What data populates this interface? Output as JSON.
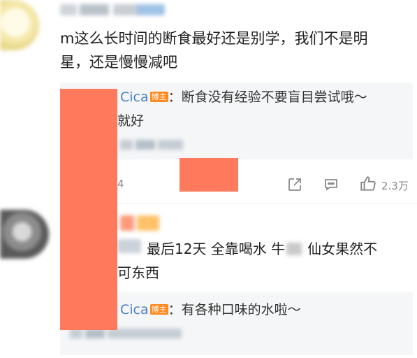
{
  "comment1": {
    "text_line1": "m这么长时间的断食最好还是别学，我们不是明",
    "text_line2": "星，还是慢慢减吧",
    "reply": {
      "author": "Cica",
      "badge": "博主",
      "text_line1": "：断食没有经验不要盲目尝试哦～",
      "text_line2": "就好"
    },
    "actions": {
      "partial_count": "4",
      "like_count": "2.3万"
    }
  },
  "comment2": {
    "text_line1": "最后12天 全靠喝水 牛",
    "text_line1b": "仙女果然不",
    "text_line2": "可东西",
    "reply": {
      "author": "Cica",
      "badge": "博主",
      "text": "：有各种口味的水啦～"
    }
  },
  "icons": [
    "share-icon",
    "comment-icon",
    "like-icon"
  ],
  "colors": {
    "link": "#4b81c2",
    "badge": "#ff8a1f",
    "redaction": "#ff7a5c",
    "reply_bg": "#f5f6f7"
  }
}
